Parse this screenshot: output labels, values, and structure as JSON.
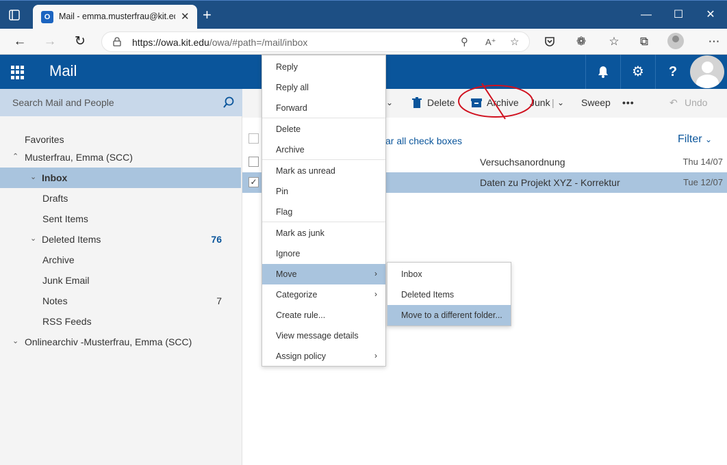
{
  "browser": {
    "tab_title": "Mail - emma.musterfrau@kit.edu",
    "tab_favicon_letter": "O",
    "url_host": "https://owa.kit.edu",
    "url_path": "/owa/#path=/mail/inbox"
  },
  "header": {
    "app_name": "Mail",
    "brand_color": "#0a559b"
  },
  "search": {
    "placeholder": "Search Mail and People"
  },
  "folders": [
    {
      "label": "Favorites",
      "count": ""
    },
    {
      "label": "Musterfrau, Emma (SCC)",
      "count": ""
    },
    {
      "label": "Inbox",
      "count": ""
    },
    {
      "label": "Drafts",
      "count": ""
    },
    {
      "label": "Sent Items",
      "count": ""
    },
    {
      "label": "Deleted Items",
      "count": "76"
    },
    {
      "label": "Archive",
      "count": ""
    },
    {
      "label": "Junk Email",
      "count": ""
    },
    {
      "label": "Notes",
      "count": "7"
    },
    {
      "label": "RSS Feeds",
      "count": ""
    },
    {
      "label": "Onlinearchiv -Musterfrau, Emma (SCC)",
      "count": ""
    }
  ],
  "commands": {
    "delete": "Delete",
    "archive": "Archive",
    "junk": "Junk",
    "sweep": "Sweep",
    "undo": "Undo"
  },
  "list": {
    "clear_all": "ar all check boxes",
    "filter": "Filter",
    "rows": [
      {
        "subject": "Versuchsanordnung",
        "date": "Thu 14/07"
      },
      {
        "subject": "Daten zu Projekt XYZ - Korrektur",
        "date": "Tue 12/07"
      }
    ]
  },
  "context_menu": [
    "Reply",
    "Reply all",
    "Forward",
    "Delete",
    "Archive",
    "Mark as unread",
    "Pin",
    "Flag",
    "Mark as junk",
    "Ignore",
    "Move",
    "Categorize",
    "Create rule...",
    "View message details",
    "Assign policy"
  ],
  "move_submenu": [
    "Inbox",
    "Deleted Items",
    "Move to a different folder..."
  ]
}
